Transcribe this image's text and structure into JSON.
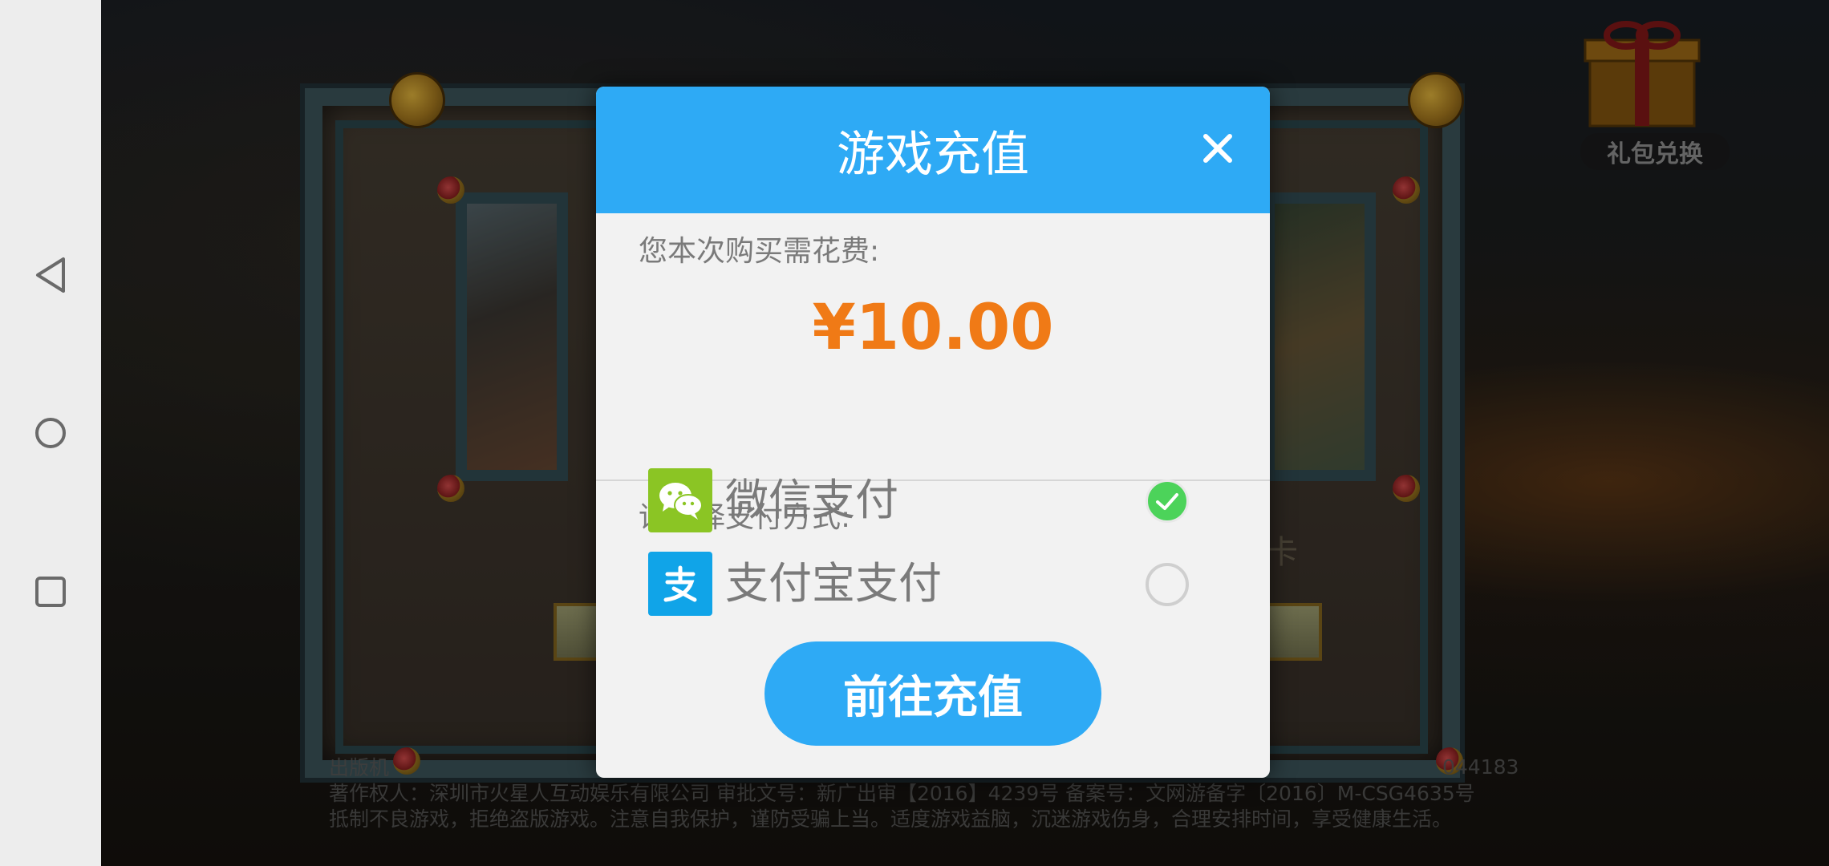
{
  "android_nav": {
    "back_icon": "back-triangle-icon",
    "home_icon": "home-circle-icon",
    "recents_icon": "recents-square-icon"
  },
  "game": {
    "gift_label": "礼包兑换",
    "side_char": "卡",
    "footer_right_text": "044183",
    "footer_lines": [
      "出版机",
      "著作权人：深圳市火星人互动娱乐有限公司 审批文号：新广出审【2016】4239号 备案号：文网游备字〔2016〕M-CSG4635号",
      "抵制不良游戏，拒绝盗版游戏。注意自我保护，谨防受骗上当。适度游戏益脑，沉迷游戏伤身，合理安排时间，享受健康生活。"
    ]
  },
  "dialog": {
    "title": "游戏充值",
    "close_icon": "close-icon",
    "cost_label": "您本次购买需花费:",
    "price": "¥10.00",
    "method_label": "请选择支付方式:",
    "methods": [
      {
        "name": "微信支付",
        "icon": "wechat-icon",
        "selected": true
      },
      {
        "name": "支付宝支付",
        "icon": "alipay-icon",
        "selected": false
      }
    ],
    "submit_label": "前往充值"
  },
  "colors": {
    "header_blue": "#2eaaf5",
    "price_orange": "#f07a16",
    "wechat_green": "#8bc524",
    "alipay_blue": "#10a4e8",
    "selected_green": "#4cd35a"
  }
}
